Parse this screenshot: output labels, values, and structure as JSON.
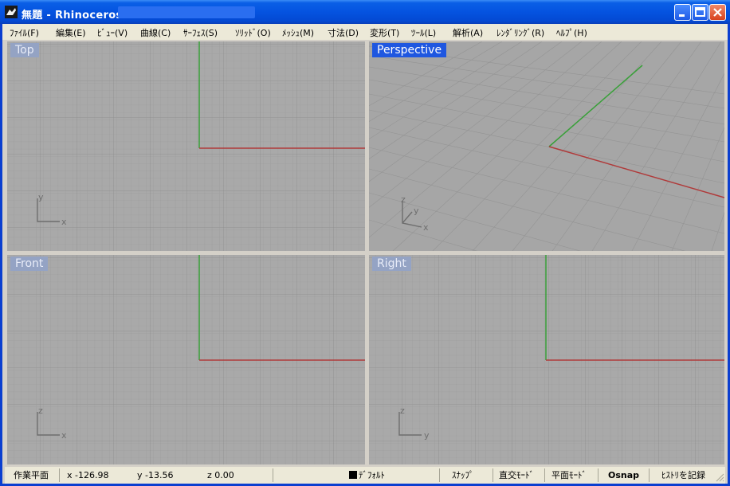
{
  "window": {
    "title": "無題 - Rhinoceros"
  },
  "menu": [
    {
      "name": "file",
      "label": "ﾌｧｲﾙ(F)"
    },
    {
      "name": "edit",
      "label": "編集(E)"
    },
    {
      "name": "view",
      "label": "ﾋﾞｭｰ(V)"
    },
    {
      "name": "curve",
      "label": "曲線(C)"
    },
    {
      "name": "surface",
      "label": "ｻｰﾌｪｽ(S)"
    },
    {
      "name": "solid",
      "label": "ｿﾘｯﾄﾞ(O)"
    },
    {
      "name": "mesh",
      "label": "ﾒｯｼｭ(M)"
    },
    {
      "name": "dimension",
      "label": "寸法(D)"
    },
    {
      "name": "transform",
      "label": "変形(T)"
    },
    {
      "name": "tools",
      "label": "ﾂｰﾙ(L)"
    },
    {
      "name": "analyze",
      "label": "解析(A)"
    },
    {
      "name": "render",
      "label": "ﾚﾝﾀﾞﾘﾝｸﾞ(R)"
    },
    {
      "name": "help",
      "label": "ﾍﾙﾌﾟ(H)"
    }
  ],
  "viewports": {
    "top": {
      "label": "Top",
      "axis1": "x",
      "axis2": "y"
    },
    "perspective": {
      "label": "Perspective",
      "axis1": "x",
      "axis2": "y",
      "axis3": "z"
    },
    "front": {
      "label": "Front",
      "axis1": "x",
      "axis2": "z"
    },
    "right": {
      "label": "Right",
      "axis1": "y",
      "axis2": "z"
    }
  },
  "status": {
    "cplane": "作業平面",
    "x": "x -126.98",
    "y": "y -13.56",
    "z": "z 0.00",
    "layer": "ﾃﾞﾌｫﾙﾄ",
    "snap": "ｽﾅｯﾌﾟ",
    "ortho": "直交ﾓｰﾄﾞ",
    "planar": "平面ﾓｰﾄﾞ",
    "osnap": "Osnap",
    "history": "ﾋｽﾄﾘを記録"
  },
  "colors": {
    "x_axis": "#b03a3a",
    "y_axis": "#3aa03a",
    "viewport_bg": "#a9a9a9",
    "active_label": "#1f57e0"
  }
}
